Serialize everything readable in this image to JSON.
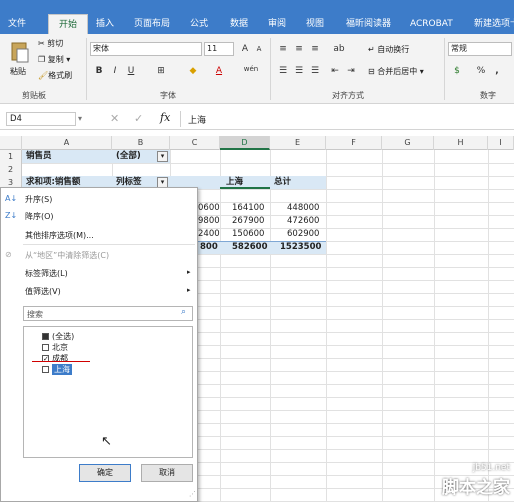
{
  "tabs": [
    "文件",
    "开始",
    "插入",
    "页面布局",
    "公式",
    "数据",
    "审阅",
    "视图",
    "福昕阅读器",
    "ACROBAT",
    "新建选项卡"
  ],
  "clipboard": {
    "paste": "粘贴",
    "cut": "剪切",
    "copy": "复制",
    "format_painter": "格式刷",
    "group": "剪贴板"
  },
  "font": {
    "name": "宋体",
    "size": "11",
    "group": "字体",
    "bold": "B",
    "italic": "I",
    "underline": "U",
    "wen": "wén"
  },
  "alignment": {
    "wrap": "自动换行",
    "merge": "合并后居中",
    "group": "对齐方式"
  },
  "number": {
    "format": "常规",
    "percent": "%",
    "comma": ",",
    "group": "数字"
  },
  "formula_bar": {
    "name_box": "D4",
    "fx": "fx",
    "value": "上海"
  },
  "columns": [
    "A",
    "B",
    "C",
    "D",
    "E",
    "F",
    "G",
    "H",
    "I"
  ],
  "rows": [
    "1",
    "2",
    "3"
  ],
  "cells": {
    "a1": "销售员",
    "b1": "(全部)",
    "a3": "求和项:销售额",
    "b3": "列标签",
    "d3": "上海",
    "e3": "总计",
    "c4": "0600",
    "d4": "164100",
    "e4": "448000",
    "c5": "9800",
    "d5": "267900",
    "e5": "472600",
    "c6": "2400",
    "d6": "150600",
    "e6": "602900",
    "c7": "800",
    "d7": "582600",
    "e7": "1523500"
  },
  "menu": {
    "sort_asc": "升序(S)",
    "sort_desc": "降序(O)",
    "more_sort": "其他排序选项(M)...",
    "clear_filter": "从“地区”中清除筛选(C)",
    "label_filter": "标签筛选(L)",
    "value_filter": "值筛选(V)",
    "search_placeholder": "搜索",
    "items": [
      {
        "label": "(全选)",
        "state": "partial"
      },
      {
        "label": "北京",
        "state": "unchecked"
      },
      {
        "label": "成都",
        "state": "checked"
      },
      {
        "label": "上海",
        "state": "unchecked"
      }
    ],
    "ok": "确定",
    "cancel": "取消"
  },
  "watermark": {
    "line1": "jb51.net",
    "line2": "脚本之家"
  },
  "colors": {
    "accent": "#3d7cc9",
    "green": "#217346",
    "selected": "#d9e8f5"
  }
}
